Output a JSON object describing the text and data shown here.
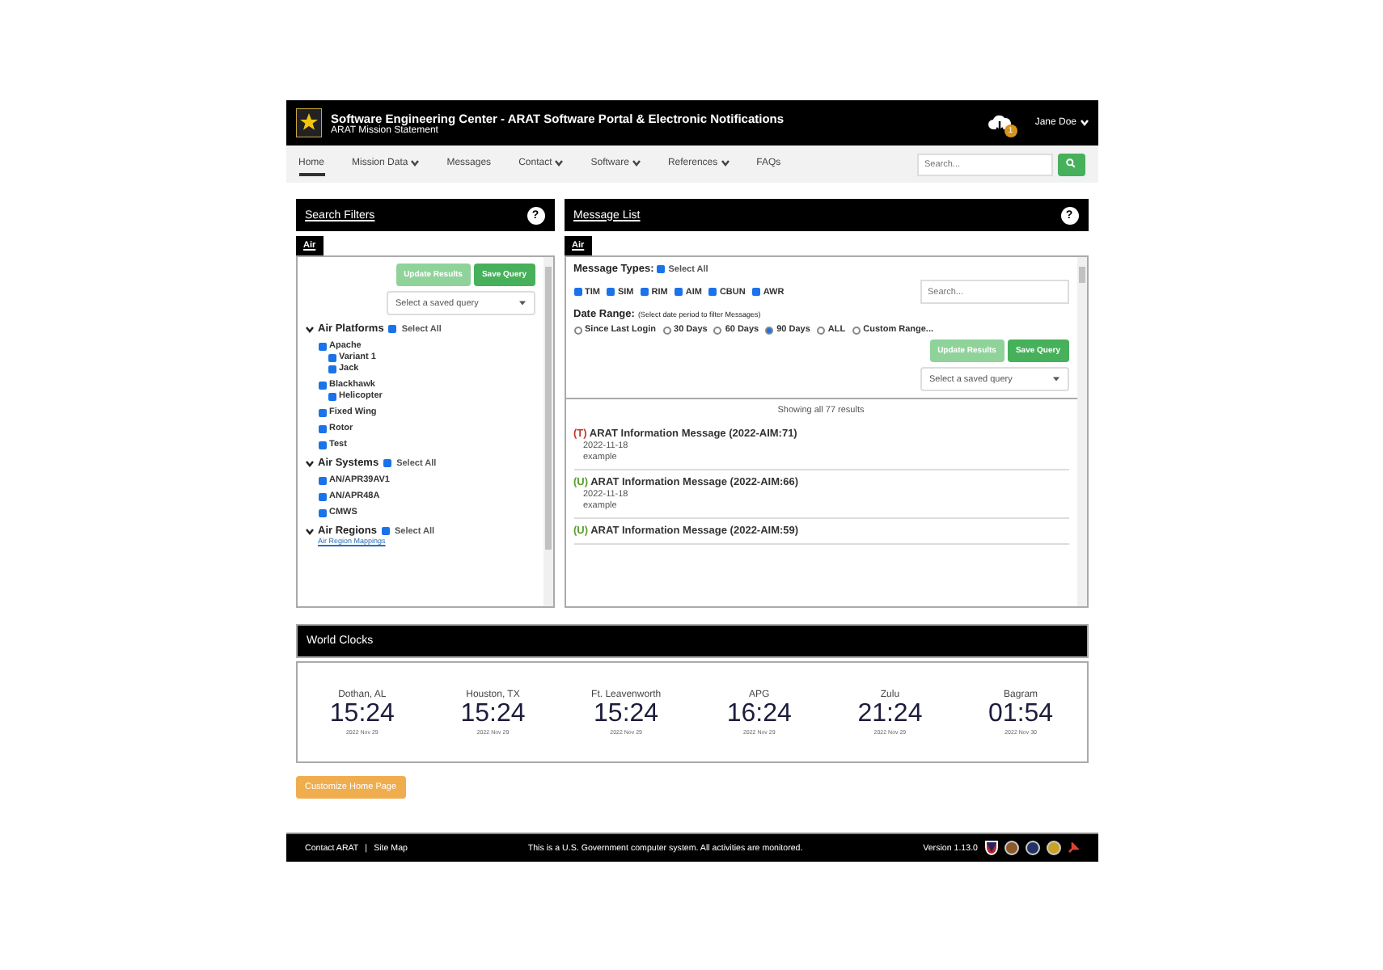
{
  "header": {
    "title": "Software Engineering Center - ARAT Software Portal & Electronic Notifications",
    "subtitle": "ARAT Mission Statement",
    "notification_count": "1",
    "user": "Jane Doe"
  },
  "nav": {
    "items": [
      {
        "label": "Home",
        "selected": true,
        "dropdown": false
      },
      {
        "label": "Mission Data",
        "selected": false,
        "dropdown": true
      },
      {
        "label": "Messages",
        "selected": false,
        "dropdown": false
      },
      {
        "label": "Contact",
        "selected": false,
        "dropdown": true
      },
      {
        "label": "Software",
        "selected": false,
        "dropdown": true
      },
      {
        "label": "References",
        "selected": false,
        "dropdown": true
      },
      {
        "label": "FAQs",
        "selected": false,
        "dropdown": false
      }
    ],
    "search_placeholder": "Search..."
  },
  "search_filters": {
    "title": "Search Filters",
    "help": "?",
    "tab": "Air",
    "update_button": "Update Results",
    "save_button": "Save Query",
    "saved_query_placeholder": "Select a saved query",
    "groups": [
      {
        "title": "Air Platforms",
        "select_all": "Select All",
        "select_all_checked": true,
        "items": [
          {
            "label": "Apache",
            "checked": true,
            "children": [
              {
                "label": "Variant 1",
                "checked": true
              },
              {
                "label": "Jack",
                "checked": true
              }
            ]
          },
          {
            "label": "Blackhawk",
            "checked": true,
            "children": [
              {
                "label": "Helicopter",
                "checked": true
              }
            ]
          },
          {
            "label": "Fixed Wing",
            "checked": true
          },
          {
            "label": "Rotor",
            "checked": true
          },
          {
            "label": "Test",
            "checked": true
          }
        ]
      },
      {
        "title": "Air Systems",
        "select_all": "Select All",
        "select_all_checked": true,
        "items": [
          {
            "label": "AN/APR39AV1",
            "checked": true
          },
          {
            "label": "AN/APR48A",
            "checked": true
          },
          {
            "label": "CMWS",
            "checked": true
          }
        ]
      },
      {
        "title": "Air Regions",
        "select_all": "Select All",
        "select_all_checked": true,
        "link": "Air Region Mappings"
      }
    ]
  },
  "message_list": {
    "title": "Message List",
    "help": "?",
    "tab": "Air",
    "types_label": "Message Types:",
    "select_all": "Select All",
    "select_all_checked": true,
    "types": [
      {
        "label": "TIM",
        "checked": true
      },
      {
        "label": "SIM",
        "checked": true
      },
      {
        "label": "RIM",
        "checked": true
      },
      {
        "label": "AIM",
        "checked": true
      },
      {
        "label": "CBUN",
        "checked": true
      },
      {
        "label": "AWR",
        "checked": true
      }
    ],
    "search_placeholder": "Search...",
    "date_label": "Date Range:",
    "date_hint": "(Select date period to filter Messages)",
    "ranges": [
      {
        "label": "Since Last Login",
        "selected": false
      },
      {
        "label": "30 Days",
        "selected": false
      },
      {
        "label": "60 Days",
        "selected": false
      },
      {
        "label": "90 Days",
        "selected": true
      },
      {
        "label": "ALL",
        "selected": false
      },
      {
        "label": "Custom Range...",
        "selected": false
      }
    ],
    "update_button": "Update Results",
    "save_button": "Save Query",
    "saved_query_placeholder": "Select a saved query",
    "results": "Showing all 77 results",
    "messages": [
      {
        "tag": "(T)",
        "color": "#c0392b",
        "title": "ARAT Information Message (2022-AIM:71)",
        "date": "2022-11-18",
        "body": "example"
      },
      {
        "tag": "(U)",
        "color": "#5a9e2f",
        "title": "ARAT Information Message (2022-AIM:66)",
        "date": "2022-11-18",
        "body": "example"
      },
      {
        "tag": "(U)",
        "color": "#5a9e2f",
        "title": "ARAT Information Message (2022-AIM:59)"
      }
    ]
  },
  "world_clocks": {
    "title": "World Clocks",
    "clocks": [
      {
        "city": "Dothan, AL",
        "time": "15:24",
        "date": "2022 Nov 29"
      },
      {
        "city": "Houston, TX",
        "time": "15:24",
        "date": "2022 Nov 29"
      },
      {
        "city": "Ft. Leavenworth",
        "time": "15:24",
        "date": "2022 Nov 29"
      },
      {
        "city": "APG",
        "time": "16:24",
        "date": "2022 Nov 29"
      },
      {
        "city": "Zulu",
        "time": "21:24",
        "date": "2022 Nov 29"
      },
      {
        "city": "Bagram",
        "time": "01:54",
        "date": "2022 Nov 30"
      }
    ]
  },
  "customize_button": "Customize Home Page",
  "footer": {
    "contact": "Contact ARAT",
    "sitemap": "Site Map",
    "separator": "|",
    "notice": "This is a U.S. Government computer system. All activities are monitored.",
    "version": "Version 1.13.0"
  }
}
